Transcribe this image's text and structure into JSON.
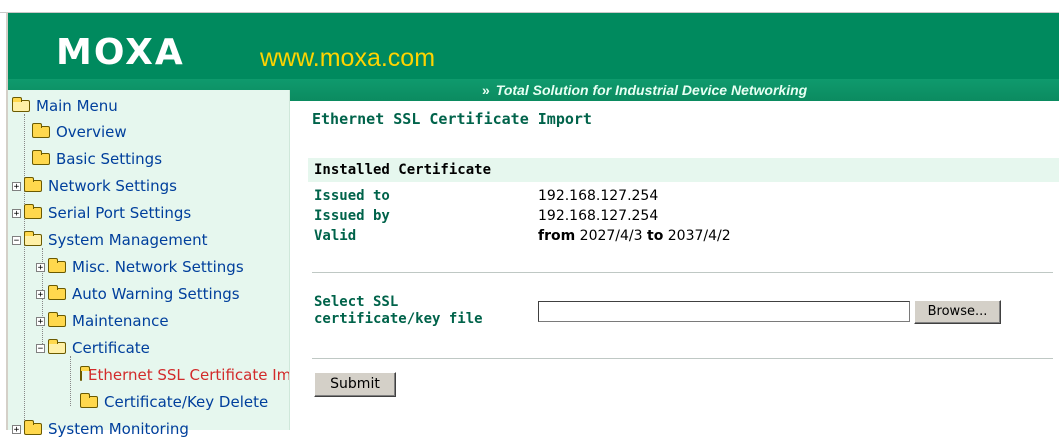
{
  "header": {
    "logo": "MOXA",
    "site": "www.moxa.com",
    "tagline": "Total Solution for Industrial Device Networking",
    "colors": {
      "header_bg": "#008a5e",
      "site_text": "#ffd400"
    }
  },
  "sidebar": {
    "items": [
      {
        "label": "Main Menu",
        "icon": "folder-open-icon"
      },
      {
        "label": "Overview",
        "icon": "folder-icon"
      },
      {
        "label": "Basic Settings",
        "icon": "folder-icon"
      },
      {
        "label": "Network Settings",
        "icon": "folder-icon"
      },
      {
        "label": "Serial Port Settings",
        "icon": "folder-icon"
      },
      {
        "label": "System Management",
        "icon": "folder-open-icon"
      },
      {
        "label": "Misc. Network Settings",
        "icon": "folder-icon"
      },
      {
        "label": "Auto Warning Settings",
        "icon": "folder-icon"
      },
      {
        "label": "Maintenance",
        "icon": "folder-icon"
      },
      {
        "label": "Certificate",
        "icon": "folder-open-icon"
      },
      {
        "label": "Ethernet SSL Certificate Import",
        "icon": "folder-icon"
      },
      {
        "label": "Certificate/Key Delete",
        "icon": "folder-icon"
      },
      {
        "label": "System Monitoring",
        "icon": "folder-icon"
      }
    ]
  },
  "main": {
    "title": "Ethernet SSL Certificate Import",
    "section_title": "Installed Certificate",
    "issued_to_label": "Issued to",
    "issued_to_value": "192.168.127.254",
    "issued_by_label": "Issued by",
    "issued_by_value": "192.168.127.254",
    "valid_label": "Valid",
    "valid_from_word": "from",
    "valid_from": "2027/4/3",
    "valid_to_word": "to",
    "valid_to": "2037/4/2",
    "file_label": "Select SSL certificate/key file",
    "file_value": "",
    "browse_label": "Browse...",
    "submit_label": "Submit"
  }
}
